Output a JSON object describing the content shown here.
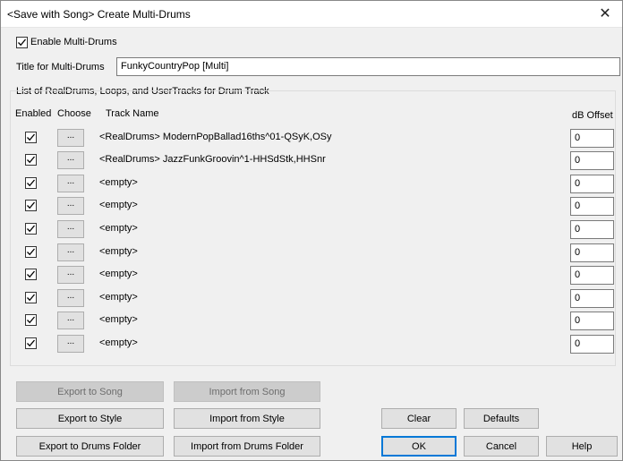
{
  "window": {
    "title": "<Save with Song> Create Multi-Drums",
    "close_glyph": "✕"
  },
  "enable": {
    "label": "Enable Multi-Drums",
    "checked": true
  },
  "title_field": {
    "label": "Title for Multi-Drums",
    "value": "FunkyCountryPop [Multi]"
  },
  "group": {
    "label": "List of RealDrums, Loops, and UserTracks for Drum Track"
  },
  "columns": {
    "enabled": "Enabled",
    "choose": "Choose",
    "track_name": "Track Name",
    "db_offset": "dB Offset"
  },
  "rows": [
    {
      "enabled": true,
      "choose": "...",
      "name": "<RealDrums> ModernPopBallad16ths^01-QSyK,OSy",
      "db": "0"
    },
    {
      "enabled": true,
      "choose": "...",
      "name": "<RealDrums> JazzFunkGroovin^1-HHSdStk,HHSnr",
      "db": "0"
    },
    {
      "enabled": true,
      "choose": "...",
      "name": "<empty>",
      "db": "0"
    },
    {
      "enabled": true,
      "choose": "...",
      "name": "<empty>",
      "db": "0"
    },
    {
      "enabled": true,
      "choose": "...",
      "name": "<empty>",
      "db": "0"
    },
    {
      "enabled": true,
      "choose": "...",
      "name": "<empty>",
      "db": "0"
    },
    {
      "enabled": true,
      "choose": "...",
      "name": "<empty>",
      "db": "0"
    },
    {
      "enabled": true,
      "choose": "...",
      "name": "<empty>",
      "db": "0"
    },
    {
      "enabled": true,
      "choose": "...",
      "name": "<empty>",
      "db": "0"
    },
    {
      "enabled": true,
      "choose": "...",
      "name": "<empty>",
      "db": "0"
    }
  ],
  "buttons": {
    "export_song": "Export to Song",
    "import_song": "Import from Song",
    "export_style": "Export to Style",
    "import_style": "Import from Style",
    "clear": "Clear",
    "defaults": "Defaults",
    "export_drums_folder": "Export to  Drums Folder",
    "import_drums_folder": "Import from  Drums Folder",
    "ok": "OK",
    "cancel": "Cancel",
    "help": "Help"
  }
}
